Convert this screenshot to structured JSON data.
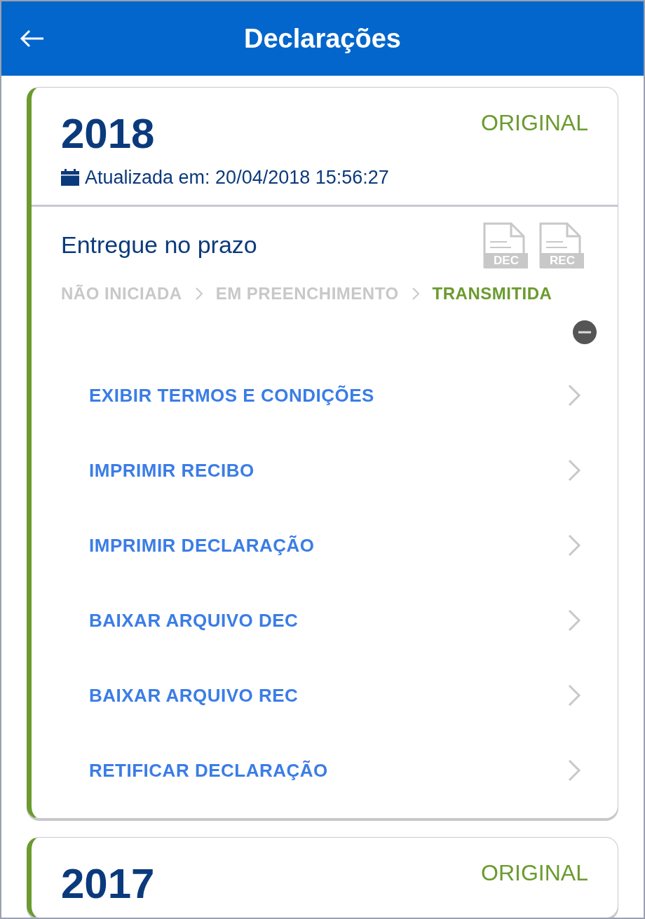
{
  "header": {
    "title": "Declarações"
  },
  "declarations": [
    {
      "year": "2018",
      "type": "ORIGINAL",
      "updated": "Atualizada em: 20/04/2018 15:56:27",
      "status": "Entregue no prazo",
      "files": [
        "DEC",
        "REC"
      ],
      "expanded": true,
      "steps": [
        {
          "label": "NÃO INICIADA",
          "selected": false
        },
        {
          "label": "EM PREENCHIMENTO",
          "selected": false
        },
        {
          "label": "TRANSMITIDA",
          "selected": true
        }
      ],
      "actions": [
        "EXIBIR TERMOS E CONDIÇÕES",
        "IMPRIMIR RECIBO",
        "IMPRIMIR DECLARAÇÃO",
        "BAIXAR ARQUIVO DEC",
        "BAIXAR ARQUIVO REC",
        "RETIFICAR DECLARAÇÃO"
      ]
    },
    {
      "year": "2017",
      "type": "ORIGINAL"
    }
  ]
}
